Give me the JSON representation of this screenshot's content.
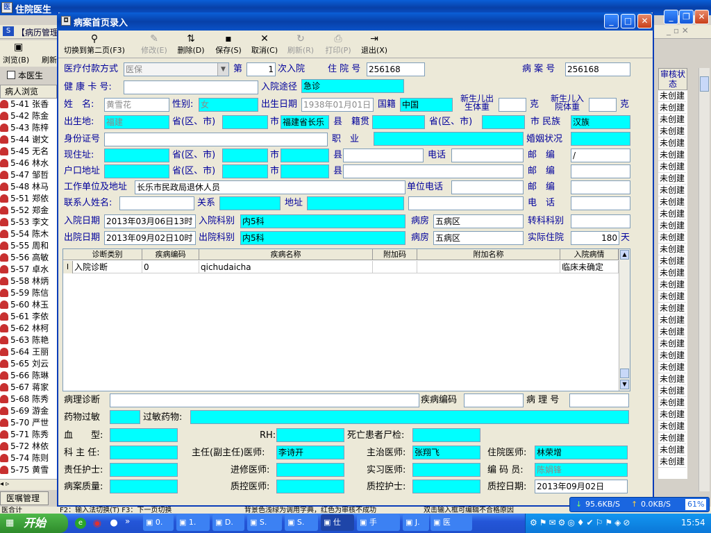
{
  "bg_window": {
    "title": "住院医生",
    "menu_text": "【病历管理"
  },
  "bg_toolbar": {
    "browse": "浏览(B)",
    "refresh": "刷新"
  },
  "bg_filter": {
    "label": "本医生",
    "list_header": "病人浏览"
  },
  "bg_patients": [
    {
      "bed": "5-41",
      "name": "张香"
    },
    {
      "bed": "5-42",
      "name": "陈金"
    },
    {
      "bed": "5-43",
      "name": "陈梓"
    },
    {
      "bed": "5-44",
      "name": "谢文"
    },
    {
      "bed": "5-45",
      "name": "无名"
    },
    {
      "bed": "5-46",
      "name": "林水"
    },
    {
      "bed": "5-47",
      "name": "邹哲"
    },
    {
      "bed": "5-48",
      "name": "林马"
    },
    {
      "bed": "5-51",
      "name": "郑依"
    },
    {
      "bed": "5-52",
      "name": "郑金"
    },
    {
      "bed": "5-53",
      "name": "李文"
    },
    {
      "bed": "5-54",
      "name": "陈木"
    },
    {
      "bed": "5-55",
      "name": "周和"
    },
    {
      "bed": "5-56",
      "name": "高敏"
    },
    {
      "bed": "5-57",
      "name": "卓水"
    },
    {
      "bed": "5-58",
      "name": "林炳"
    },
    {
      "bed": "5-59",
      "name": "陈信"
    },
    {
      "bed": "5-60",
      "name": "林玉"
    },
    {
      "bed": "5-61",
      "name": "李依"
    },
    {
      "bed": "5-62",
      "name": "林柯"
    },
    {
      "bed": "5-63",
      "name": "陈艳"
    },
    {
      "bed": "5-64",
      "name": "王丽"
    },
    {
      "bed": "5-65",
      "name": "刘云"
    },
    {
      "bed": "5-66",
      "name": "陈琳"
    },
    {
      "bed": "5-67",
      "name": "蒋家"
    },
    {
      "bed": "5-68",
      "name": "陈秀"
    },
    {
      "bed": "5-69",
      "name": "游金"
    },
    {
      "bed": "5-70",
      "name": "严世"
    },
    {
      "bed": "5-71",
      "name": "陈秀"
    },
    {
      "bed": "5-72",
      "name": "林依"
    },
    {
      "bed": "5-74",
      "name": "陈则"
    },
    {
      "bed": "5-75",
      "name": "黄雪"
    }
  ],
  "bg_right": {
    "header": "审核状态",
    "status": "未创建",
    "count": 32
  },
  "bg_bottom": {
    "tab": "医嘱管理",
    "status_left": "医合计",
    "status_hint1": "F2：输入法切换(T)  F3：下一页切换",
    "status_hint2": "背景色浅绿为调用字典，红色为审核不成功",
    "status_hint3": "双击输入框可编辑不合格原因"
  },
  "dialog": {
    "title": "病案首页录入",
    "toolbar": [
      {
        "label": "切换到第二页(F3)",
        "icon": "search-icon",
        "enabled": true
      },
      {
        "label": "修改(E)",
        "icon": "edit-icon",
        "enabled": false
      },
      {
        "label": "删除(D)",
        "icon": "delete-icon",
        "enabled": true
      },
      {
        "label": "保存(S)",
        "icon": "save-icon",
        "enabled": true
      },
      {
        "label": "取消(C)",
        "icon": "cancel-icon",
        "enabled": true
      },
      {
        "label": "刷新(R)",
        "icon": "refresh-icon",
        "enabled": false
      },
      {
        "label": "打印(P)",
        "icon": "print-icon",
        "enabled": false
      },
      {
        "label": "退出(X)",
        "icon": "exit-icon",
        "enabled": true
      }
    ],
    "form": {
      "payment_label": "医疗付款方式",
      "payment": "医保",
      "times_prefix": "第",
      "times": "1",
      "times_suffix": "次入院",
      "hosp_no_label": "住 院 号",
      "hosp_no": "256168",
      "case_no_label": "病 案 号",
      "case_no": "256168",
      "health_card_label": "健 康 卡 号:",
      "health_card": "",
      "admission_route_label": "入院途径",
      "admission_route": "急诊",
      "name_label": "姓　名:",
      "name": "黄雪花",
      "sex_label": "性别:",
      "sex": "女",
      "birth_label": "出生日期",
      "birth": "1938年01月01日",
      "nation_label": "国籍",
      "nation": "中国",
      "newborn_weight_label": "新生儿出生体重",
      "newborn_admit_label": "新生儿入院体重",
      "gram": "克",
      "birthplace_label": "出生地:",
      "birthplace": "福建",
      "prov_label": "省(区、市)",
      "city_label": "市",
      "county_label": "县",
      "birthplace_city": "福建省长乐",
      "native_label": "籍贯",
      "ethnic_label": "市 民族",
      "ethnic": "汉族",
      "id_label": "身份证号",
      "job_label": "职　业",
      "marital_label": "婚姻状况",
      "address_label": "现住址:",
      "phone_label": "电话",
      "zip_label": "邮　编",
      "zip1": "/",
      "hukou_label": "户口地址",
      "workplace_label": "工作单位及地址",
      "workplace": "长乐市民政局退休人员",
      "work_phone_label": "单位电话",
      "contact_label": "联系人姓名:",
      "relation_label": "关系",
      "contact_addr_label": "地址",
      "contact_phone_label": "电　话",
      "admit_date_label": "入院日期",
      "admit_date": "2013年03月06日13时",
      "admit_dept_label": "入院科别",
      "admit_dept": "内5科",
      "ward_label": "病房",
      "ward": "五病区",
      "transfer_label": "转科科别",
      "disch_date_label": "出院日期",
      "disch_date": "2013年09月02日10时",
      "disch_dept_label": "出院科别",
      "disch_dept": "内5科",
      "ward2": "五病区",
      "stay_label": "实际住院",
      "stay_days": "180",
      "day_unit": "天"
    },
    "grid": {
      "headers": [
        "诊断类别",
        "疾病编码",
        "疾病名称",
        "附加码",
        "附加名称",
        "入院病情"
      ],
      "rows": [
        [
          "入院诊断",
          "0",
          "qichudaicha",
          "",
          "",
          "临床未确定"
        ]
      ]
    },
    "lower": {
      "patho_label": "病理诊断",
      "disease_code_label": "疾病编码",
      "patho_no_label": "病 理 号",
      "allergy_label": "药物过敏",
      "allergy_drug_label": "过敏药物:",
      "blood_label": "血　　型:",
      "rh_label": "RH:",
      "autopsy_label": "死亡患者尸检:",
      "director_label": "科 主 任:",
      "chief_label": "主任(副主任)医师:",
      "chief": "李诗开",
      "attending_label": "主治医师:",
      "attending": "张翔飞",
      "resident_label": "住院医师:",
      "resident": "林荣增",
      "nurse_label": "责任护士:",
      "fellow_label": "进修医师:",
      "intern_label": "实习医师:",
      "coder_label": "编 码 员:",
      "coder": "陈娟锋",
      "quality_label": "病案质量:",
      "qc_doctor_label": "质控医师:",
      "qc_nurse_label": "质控护士:",
      "qc_date_label": "质控日期:",
      "qc_date": "2013年09月02日"
    }
  },
  "network": {
    "down": "95.6KB/S",
    "up": "0.0KB/S",
    "pct": "61%"
  },
  "taskbar": {
    "start": "开始",
    "items": [
      "0.",
      "1.",
      "D.",
      "S.",
      "S.",
      "仕",
      "手",
      "J.",
      "医"
    ],
    "time": "15:54"
  }
}
